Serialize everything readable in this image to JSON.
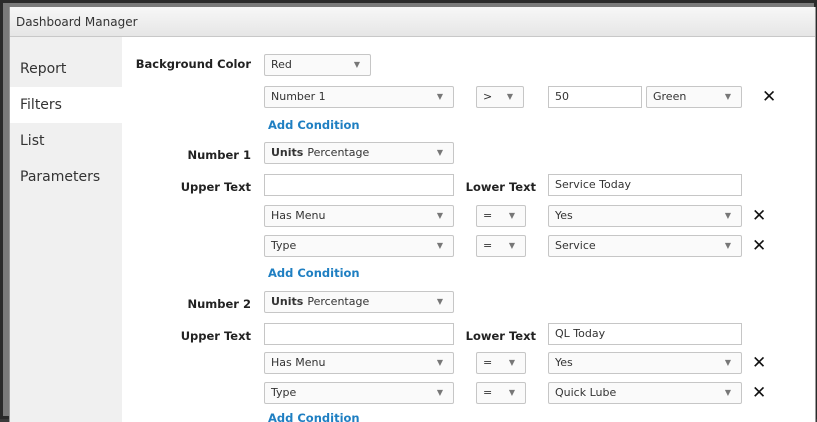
{
  "window": {
    "title": "Dashboard Manager"
  },
  "sidebar": {
    "items": [
      {
        "label": "Report"
      },
      {
        "label": "Filters"
      },
      {
        "label": "List"
      },
      {
        "label": "Parameters"
      }
    ]
  },
  "arrow": "▼",
  "remove_glyph": "✕",
  "background": {
    "label": "Background Color",
    "value": "Red",
    "condition": {
      "field": "Number 1",
      "operator": ">",
      "value": "50",
      "color": "Green"
    },
    "add_condition": "Add Condition"
  },
  "number1": {
    "label": "Number 1",
    "units_label": "Units",
    "units_value": "Percentage",
    "upper_label": "Upper Text",
    "upper_value": "",
    "lower_label": "Lower Text",
    "lower_value": "Service Today",
    "conditions": [
      {
        "field": "Has Menu",
        "operator": "=",
        "value": "Yes"
      },
      {
        "field": "Type",
        "operator": "=",
        "value": "Service"
      }
    ],
    "add_condition": "Add Condition"
  },
  "number2": {
    "label": "Number 2",
    "units_label": "Units",
    "units_value": "Percentage",
    "upper_label": "Upper Text",
    "upper_value": "",
    "lower_label": "Lower Text",
    "lower_value": "QL Today",
    "conditions": [
      {
        "field": "Has Menu",
        "operator": "=",
        "value": "Yes"
      },
      {
        "field": "Type",
        "operator": "=",
        "value": "Quick Lube"
      }
    ],
    "add_condition": "Add Condition"
  }
}
